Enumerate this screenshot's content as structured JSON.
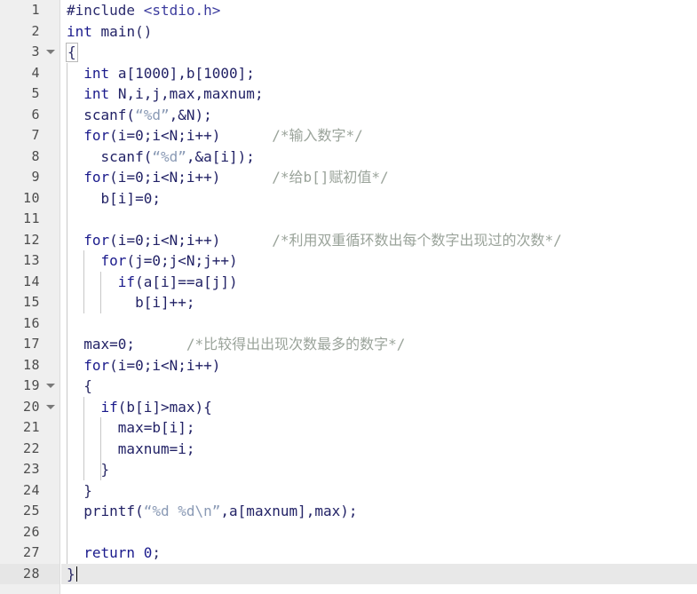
{
  "editor": {
    "language": "C",
    "colors": {
      "background": "#ffffff",
      "gutter_background": "#efefef",
      "gutter_text": "#4d4d4d",
      "current_line_background": "#e8e8e8",
      "code_default": "#1a1a6e",
      "keyword": "#1a1a8c",
      "string": "#8a9ab5",
      "comment": "#9aa39a",
      "indent_guide": "#c8c8c8",
      "caret": "#000000"
    },
    "current_line_number": 28,
    "caret_column_after": "}"
  },
  "lines": [
    {
      "number": "1",
      "fold": false,
      "guides": 0,
      "current": false,
      "tokens": [
        {
          "text": "#include",
          "cls": "pre"
        },
        {
          "text": " ",
          "cls": "punc"
        },
        {
          "text": "<stdio.h>",
          "cls": "hdr"
        }
      ]
    },
    {
      "number": "2",
      "fold": false,
      "guides": 0,
      "current": false,
      "tokens": [
        {
          "text": "int",
          "cls": "kw"
        },
        {
          "text": " ",
          "cls": "punc"
        },
        {
          "text": "main",
          "cls": "id"
        },
        {
          "text": "()",
          "cls": "punc"
        }
      ]
    },
    {
      "number": "3",
      "fold": true,
      "guides": 0,
      "current": false,
      "tokens": [
        {
          "text": "{",
          "cls": "punc",
          "box": true
        }
      ]
    },
    {
      "number": "4",
      "fold": false,
      "guides": 1,
      "current": false,
      "tokens": [
        {
          "text": "  ",
          "cls": "punc"
        },
        {
          "text": "int",
          "cls": "kw"
        },
        {
          "text": " ",
          "cls": "punc"
        },
        {
          "text": "a[1000],b[1000];",
          "cls": "id"
        }
      ]
    },
    {
      "number": "5",
      "fold": false,
      "guides": 1,
      "current": false,
      "tokens": [
        {
          "text": "  ",
          "cls": "punc"
        },
        {
          "text": "int",
          "cls": "kw"
        },
        {
          "text": " ",
          "cls": "punc"
        },
        {
          "text": "N,i,j,max,maxnum;",
          "cls": "id"
        }
      ]
    },
    {
      "number": "6",
      "fold": false,
      "guides": 1,
      "current": false,
      "tokens": [
        {
          "text": "  ",
          "cls": "punc"
        },
        {
          "text": "scanf(",
          "cls": "id"
        },
        {
          "text": "“%d”",
          "cls": "str"
        },
        {
          "text": ",&N);",
          "cls": "id"
        }
      ]
    },
    {
      "number": "7",
      "fold": false,
      "guides": 1,
      "current": false,
      "tokens": [
        {
          "text": "  ",
          "cls": "punc"
        },
        {
          "text": "for",
          "cls": "kw"
        },
        {
          "text": "(i=0;i<N;i++)",
          "cls": "id"
        },
        {
          "text": "      ",
          "cls": "punc"
        },
        {
          "text": "/*输入数字*/",
          "cls": "cmt"
        }
      ]
    },
    {
      "number": "8",
      "fold": false,
      "guides": 1,
      "current": false,
      "tokens": [
        {
          "text": "    ",
          "cls": "punc"
        },
        {
          "text": "scanf(",
          "cls": "id"
        },
        {
          "text": "“%d”",
          "cls": "str"
        },
        {
          "text": ",&a[i]);",
          "cls": "id"
        }
      ]
    },
    {
      "number": "9",
      "fold": false,
      "guides": 1,
      "current": false,
      "tokens": [
        {
          "text": "  ",
          "cls": "punc"
        },
        {
          "text": "for",
          "cls": "kw"
        },
        {
          "text": "(i=0;i<N;i++)",
          "cls": "id"
        },
        {
          "text": "      ",
          "cls": "punc"
        },
        {
          "text": "/*给b[]赋初值*/",
          "cls": "cmt"
        }
      ]
    },
    {
      "number": "10",
      "fold": false,
      "guides": 1,
      "current": false,
      "tokens": [
        {
          "text": "    ",
          "cls": "punc"
        },
        {
          "text": "b[i]=0;",
          "cls": "id"
        }
      ]
    },
    {
      "number": "11",
      "fold": false,
      "guides": 1,
      "current": false,
      "tokens": []
    },
    {
      "number": "12",
      "fold": false,
      "guides": 1,
      "current": false,
      "tokens": [
        {
          "text": "  ",
          "cls": "punc"
        },
        {
          "text": "for",
          "cls": "kw"
        },
        {
          "text": "(i=0;i<N;i++)",
          "cls": "id"
        },
        {
          "text": "      ",
          "cls": "punc"
        },
        {
          "text": "/*利用双重循环数出每个数字出现过的次数*/",
          "cls": "cmt"
        }
      ]
    },
    {
      "number": "13",
      "fold": false,
      "guides": 2,
      "current": false,
      "tokens": [
        {
          "text": "    ",
          "cls": "punc"
        },
        {
          "text": "for",
          "cls": "kw"
        },
        {
          "text": "(j=0;j<N;j++)",
          "cls": "id"
        }
      ]
    },
    {
      "number": "14",
      "fold": false,
      "guides": 3,
      "current": false,
      "tokens": [
        {
          "text": "      ",
          "cls": "punc"
        },
        {
          "text": "if",
          "cls": "kw"
        },
        {
          "text": "(a[i]==a[j])",
          "cls": "id"
        }
      ]
    },
    {
      "number": "15",
      "fold": false,
      "guides": 3,
      "current": false,
      "tokens": [
        {
          "text": "        ",
          "cls": "punc"
        },
        {
          "text": "b[i]++;",
          "cls": "id"
        }
      ]
    },
    {
      "number": "16",
      "fold": false,
      "guides": 1,
      "current": false,
      "tokens": []
    },
    {
      "number": "17",
      "fold": false,
      "guides": 1,
      "current": false,
      "tokens": [
        {
          "text": "  ",
          "cls": "punc"
        },
        {
          "text": "max=0;",
          "cls": "id"
        },
        {
          "text": "      ",
          "cls": "punc"
        },
        {
          "text": "/*比较得出出现次数最多的数字*/",
          "cls": "cmt"
        }
      ]
    },
    {
      "number": "18",
      "fold": false,
      "guides": 1,
      "current": false,
      "tokens": [
        {
          "text": "  ",
          "cls": "punc"
        },
        {
          "text": "for",
          "cls": "kw"
        },
        {
          "text": "(i=0;i<N;i++)",
          "cls": "id"
        }
      ]
    },
    {
      "number": "19",
      "fold": true,
      "guides": 1,
      "current": false,
      "tokens": [
        {
          "text": "  ",
          "cls": "punc"
        },
        {
          "text": "{",
          "cls": "punc"
        }
      ]
    },
    {
      "number": "20",
      "fold": true,
      "guides": 2,
      "current": false,
      "tokens": [
        {
          "text": "    ",
          "cls": "punc"
        },
        {
          "text": "if",
          "cls": "kw"
        },
        {
          "text": "(b[i]>max){",
          "cls": "id"
        }
      ]
    },
    {
      "number": "21",
      "fold": false,
      "guides": 3,
      "current": false,
      "tokens": [
        {
          "text": "      ",
          "cls": "punc"
        },
        {
          "text": "max=b[i];",
          "cls": "id"
        }
      ]
    },
    {
      "number": "22",
      "fold": false,
      "guides": 3,
      "current": false,
      "tokens": [
        {
          "text": "      ",
          "cls": "punc"
        },
        {
          "text": "maxnum=i;",
          "cls": "id"
        }
      ]
    },
    {
      "number": "23",
      "fold": false,
      "guides": 3,
      "current": false,
      "tokens": [
        {
          "text": "    ",
          "cls": "punc"
        },
        {
          "text": "}",
          "cls": "punc"
        }
      ]
    },
    {
      "number": "24",
      "fold": false,
      "guides": 1,
      "current": false,
      "tokens": [
        {
          "text": "  ",
          "cls": "punc"
        },
        {
          "text": "}",
          "cls": "punc"
        }
      ]
    },
    {
      "number": "25",
      "fold": false,
      "guides": 1,
      "current": false,
      "tokens": [
        {
          "text": "  ",
          "cls": "punc"
        },
        {
          "text": "printf(",
          "cls": "id"
        },
        {
          "text": "“%d %d\\n”",
          "cls": "str"
        },
        {
          "text": ",a[maxnum],max);",
          "cls": "id"
        }
      ]
    },
    {
      "number": "26",
      "fold": false,
      "guides": 1,
      "current": false,
      "tokens": []
    },
    {
      "number": "27",
      "fold": false,
      "guides": 1,
      "current": false,
      "tokens": [
        {
          "text": "  ",
          "cls": "punc"
        },
        {
          "text": "return",
          "cls": "kw"
        },
        {
          "text": " ",
          "cls": "punc"
        },
        {
          "text": "0",
          "cls": "num"
        },
        {
          "text": ";",
          "cls": "punc"
        }
      ]
    },
    {
      "number": "28",
      "fold": false,
      "guides": 0,
      "current": true,
      "tokens": [
        {
          "text": "}",
          "cls": "punc"
        }
      ]
    }
  ]
}
